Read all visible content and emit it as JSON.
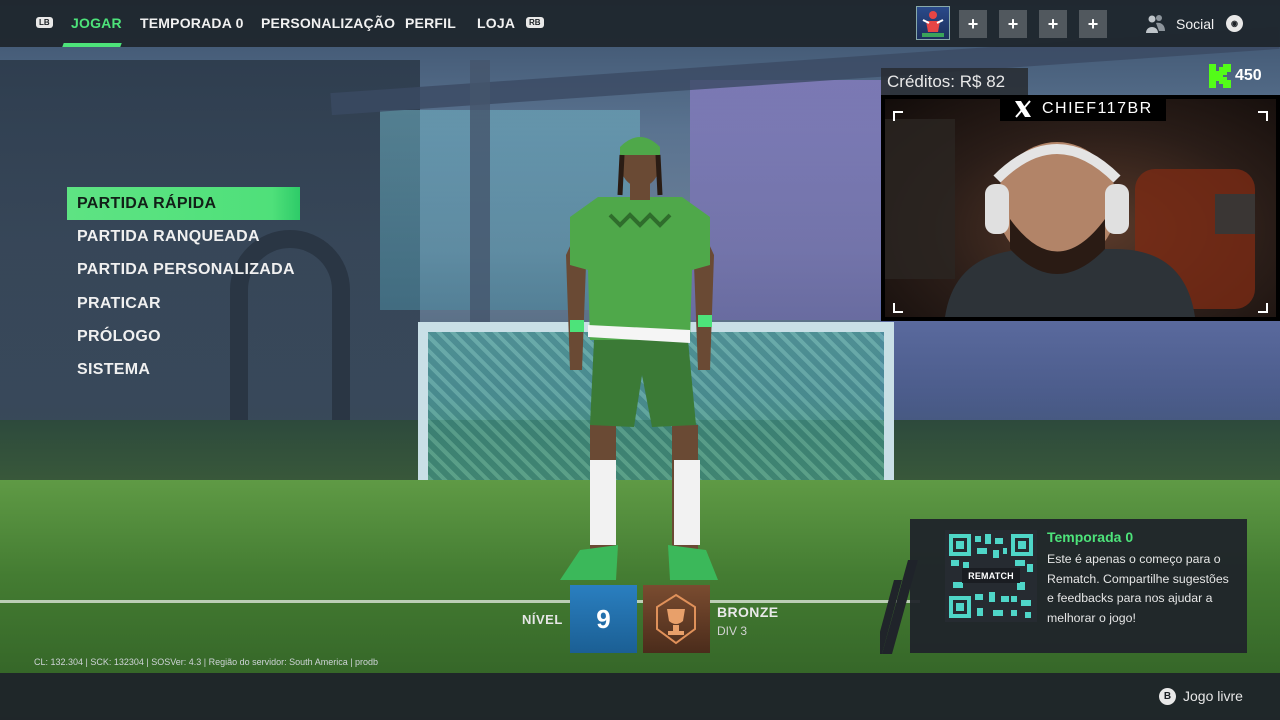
{
  "topbar": {
    "lb_label": "LB",
    "rb_label": "RB",
    "tabs": [
      {
        "label": "JOGAR",
        "active": true
      },
      {
        "label": "TEMPORADA 0",
        "active": false
      },
      {
        "label": "PERSONALIZAÇÃO",
        "active": false
      },
      {
        "label": "PERFIL",
        "active": false
      },
      {
        "label": "LOJA",
        "active": false
      }
    ],
    "party_slots": [
      "+",
      "+",
      "+",
      "+"
    ],
    "social_label": "Social",
    "accent_color": "#4de37a"
  },
  "menu": {
    "items": [
      {
        "label": "PARTIDA RÁPIDA",
        "active": true
      },
      {
        "label": "PARTIDA RANQUEADA",
        "active": false
      },
      {
        "label": "PARTIDA PERSONALIZADA",
        "active": false
      },
      {
        "label": "PRATICAR",
        "active": false
      },
      {
        "label": "PRÓLOGO",
        "active": false
      },
      {
        "label": "SISTEMA",
        "active": false
      }
    ]
  },
  "rank": {
    "nivel_label": "NÍVEL",
    "level": "9",
    "tier": "BRONZE",
    "division": "DIV 3"
  },
  "overlay": {
    "credits": "Créditos: R$ 82",
    "k_value": "450",
    "handle": "CHIEF117BR",
    "social_icon": "x-logo-icon"
  },
  "season": {
    "qr_label": "REMATCH",
    "title": "Temporada 0",
    "text": "Este é apenas o começo para o Rematch. Compartilhe sugestões e feedbacks para nos ajudar a melhorar o jogo!"
  },
  "footer": {
    "version": "CL: 132.304 | SCK: 132304 | SOSVer: 4.3 | Região do servidor: South America | prodb",
    "b_label": "B",
    "action_label": "Jogo livre"
  }
}
